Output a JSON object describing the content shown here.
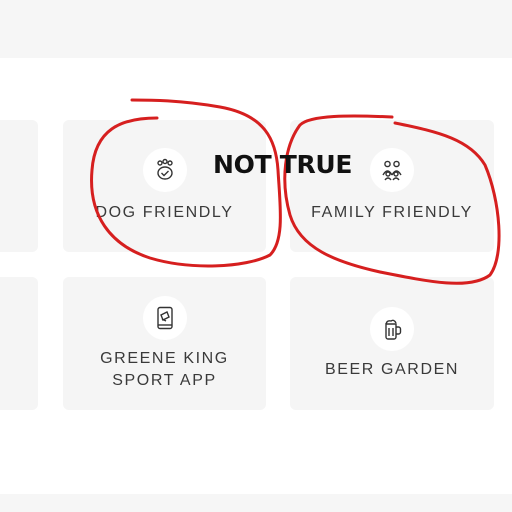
{
  "amenities": [
    {
      "label": "DOG FRIENDLY",
      "icon": "dog-paw-icon"
    },
    {
      "label": "FAMILY FRIENDLY",
      "icon": "family-icon"
    },
    {
      "label": "GREENE KING SPORT APP",
      "icon": "phone-app-icon"
    },
    {
      "label": "BEER GARDEN",
      "icon": "beer-mug-icon"
    }
  ],
  "annotation": {
    "text": "NOT TRUE",
    "ink_color": "#d61f1f"
  },
  "colors": {
    "tile_bg": "#f5f5f5",
    "label_text": "#3a3a3a"
  }
}
